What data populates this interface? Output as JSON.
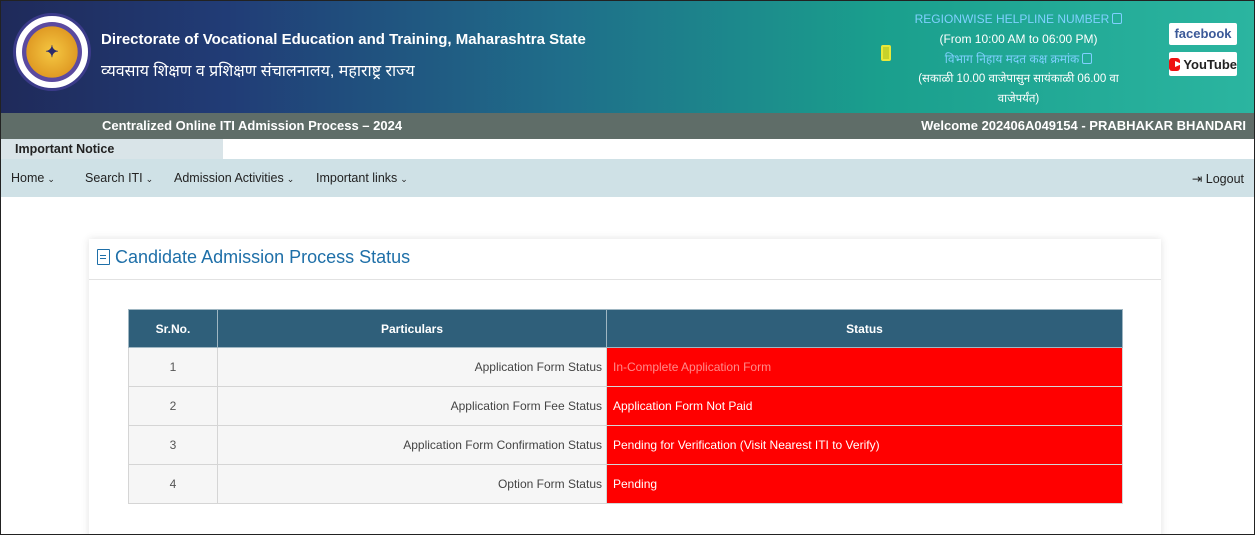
{
  "header": {
    "org_en": "Directorate of Vocational Education and Training, Maharashtra State",
    "org_mr": "व्यवसाय शिक्षण व प्रशिक्षण संचालनालय, महाराष्ट्र राज्य",
    "helpline": {
      "line1": "REGIONWISE HELPLINE NUMBER",
      "line2": "(From 10:00 AM to 06:00 PM)",
      "line3": "विभाग निहाय मदत कक्ष क्रमांक",
      "line4": "(सकाळी 10.00 वाजेपासुन सायंकाळी 06.00 वा वाजेपर्यंत)"
    },
    "facebook_label": "facebook",
    "youtube_label": "YouTube"
  },
  "titlebar": {
    "process_title": "Centralized Online ITI Admission Process – 2024",
    "welcome": "Welcome 202406A049154 - PRABHAKAR BHANDARI"
  },
  "notice": {
    "label": "Important Notice"
  },
  "nav": {
    "items": [
      {
        "label": "Home"
      },
      {
        "label": "Search ITI"
      },
      {
        "label": "Admission Activities"
      },
      {
        "label": "Important links"
      }
    ],
    "logout_label": "Logout"
  },
  "panel": {
    "title": "Candidate Admission Process Status",
    "columns": [
      "Sr.No.",
      "Particulars",
      "Status"
    ],
    "rows": [
      {
        "sr": "1",
        "particular": "Application Form Status",
        "status": "In-Complete Application Form"
      },
      {
        "sr": "2",
        "particular": "Application Form Fee Status",
        "status": "Application Form Not Paid"
      },
      {
        "sr": "3",
        "particular": "Application Form Confirmation Status",
        "status": "Pending for Verification (Visit Nearest ITI to Verify)"
      },
      {
        "sr": "4",
        "particular": "Option Form Status",
        "status": "Pending"
      }
    ]
  },
  "colors": {
    "status_red": "#ff0000",
    "table_header": "#2f5f7a",
    "title_blue": "#1e6fa8"
  }
}
